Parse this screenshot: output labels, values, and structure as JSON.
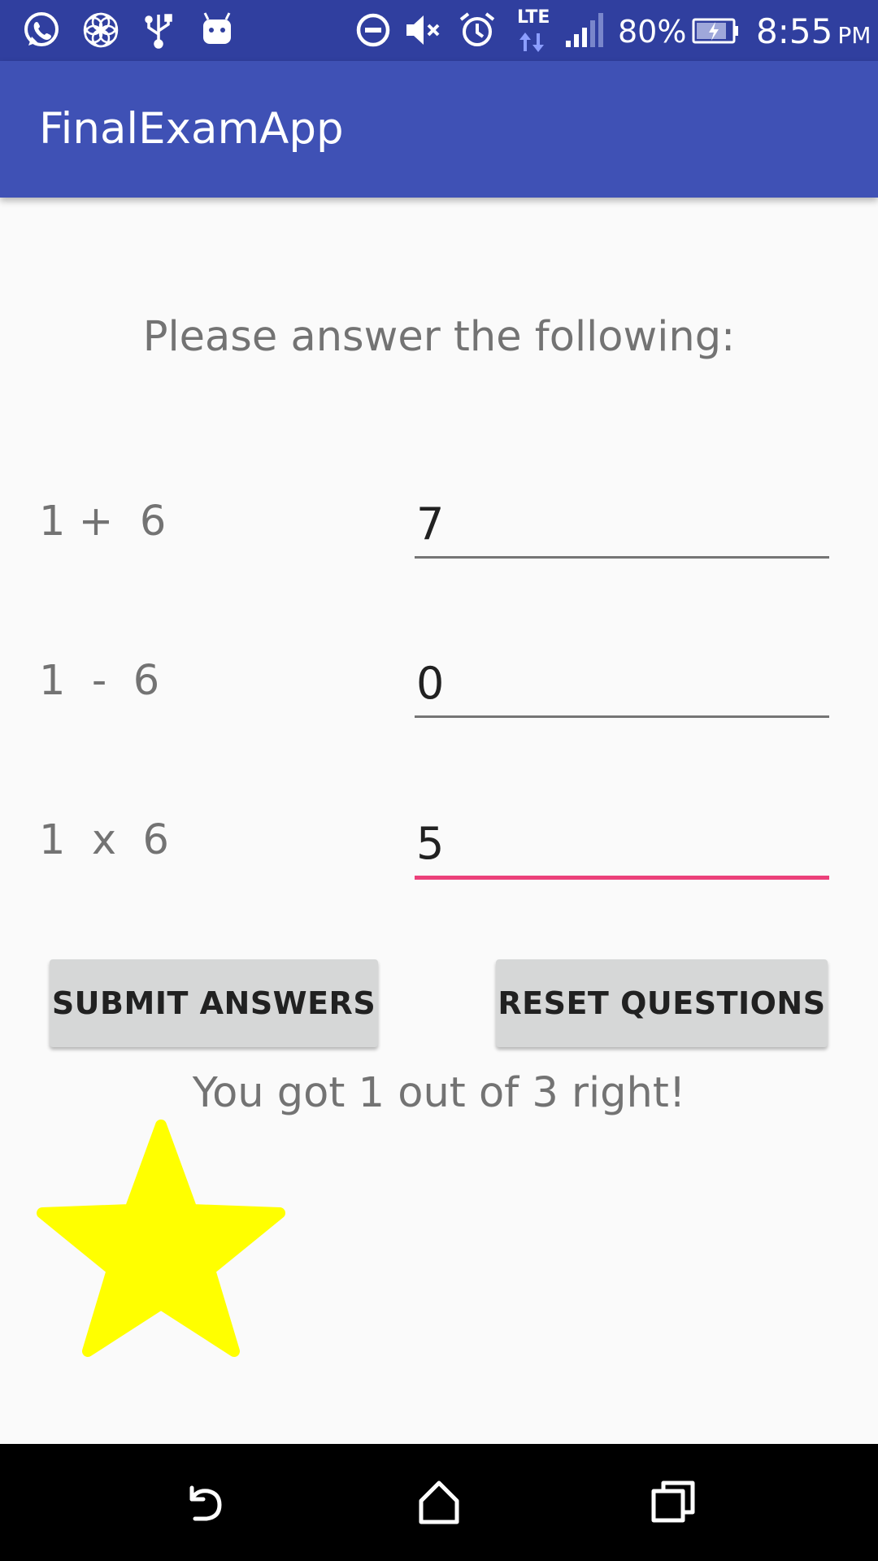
{
  "status_bar": {
    "left_icons": [
      "whatsapp-icon",
      "flower-of-life-icon",
      "usb-icon",
      "android-debug-icon"
    ],
    "right_icons": [
      "do-not-disturb-icon",
      "mute-icon",
      "alarm-icon",
      "lte-icon",
      "signal-icon",
      "battery-charging-icon"
    ],
    "network": "LTE",
    "battery": "80%",
    "time": "8:55",
    "ampm": "PM",
    "background_color": "#303f9f"
  },
  "app_bar": {
    "title": "FinalExamApp",
    "background_color": "#3f51b5"
  },
  "main": {
    "instruction": "Please answer the following:",
    "questions": [
      {
        "label": "1 +  6",
        "answer": "7",
        "focused": false
      },
      {
        "label": "1  -  6",
        "answer": "0",
        "focused": false
      },
      {
        "label": "1  x  6",
        "answer": "5",
        "focused": true
      }
    ],
    "submit_label": "SUBMIT ANSWERS",
    "reset_label": "RESET QUESTIONS",
    "result": "You got 1 out of 3 right!",
    "rating_icon": "star-icon",
    "star_color": "#ffff00",
    "accent_color": "#ec407a"
  },
  "nav_bar": {
    "buttons": [
      "back-icon",
      "home-icon",
      "recents-icon"
    ]
  }
}
